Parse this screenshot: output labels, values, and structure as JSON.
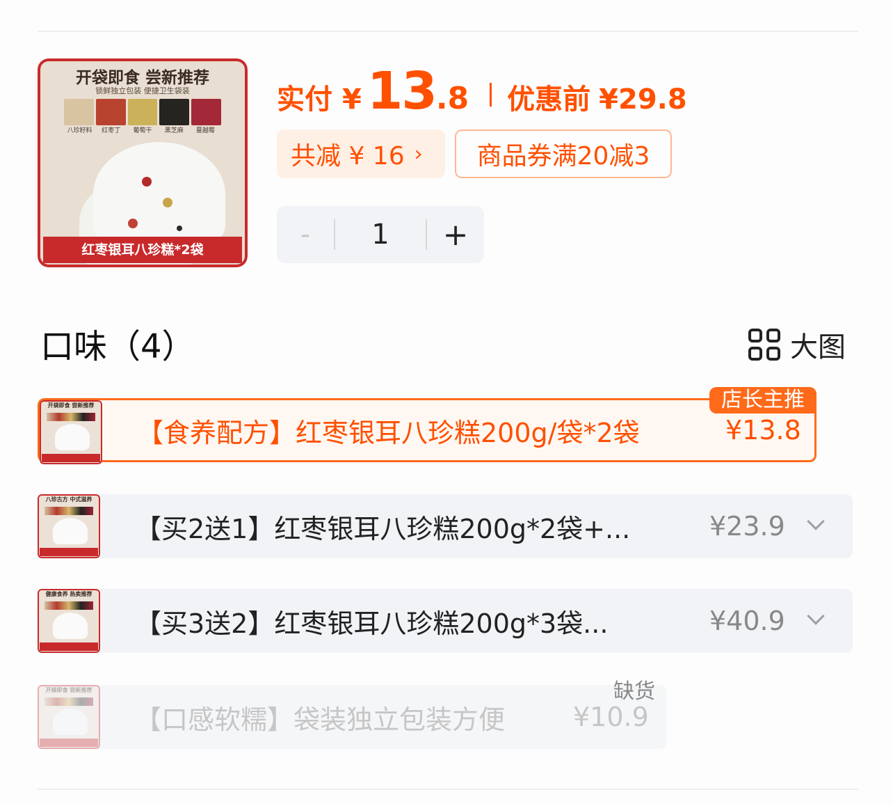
{
  "product": {
    "thumb": {
      "headline": "开袋即食 尝新推荐",
      "subline": "锁鲜独立包装 便捷卫生袋装",
      "ingredients": [
        "八珍籽料",
        "红枣丁",
        "葡萄干",
        "黑芝麻",
        "蔓越莓"
      ],
      "ingredient_colors": [
        "#d9c4a2",
        "#b8432f",
        "#cbb15a",
        "#262421",
        "#a32838"
      ],
      "banner": "红枣银耳八珍糕*2袋"
    },
    "price_label": "实付",
    "currency": "¥",
    "price_int": "13",
    "price_dec": ".8",
    "orig_label": "优惠前",
    "orig_price": "¥29.8",
    "save_label": "共减 ¥ 16",
    "save_chevron": "›",
    "coupon_label": "商品券满20减3",
    "quantity": {
      "minus": "-",
      "value": "1",
      "plus": "+"
    }
  },
  "section": {
    "title": "口味（4）",
    "bigview_label": "大图"
  },
  "options": [
    {
      "thumb_headline": "开袋即食 尝新推荐",
      "thumb_banner": "红枣银耳八珍糕*2袋",
      "name": "【食养配方】红枣银耳八珍糕200g/袋*2袋",
      "price": "¥13.8",
      "tag": "店长主推",
      "selected": true
    },
    {
      "thumb_headline": "八珍古方 中式滋养",
      "thumb_banner": "买二送一 实发三袋",
      "name": "【买2送1】红枣银耳八珍糕200g*2袋+...",
      "price": "¥23.9"
    },
    {
      "thumb_headline": "健康食养 热卖推荐",
      "thumb_banner": "买三送二 实发五袋",
      "name": "【买3送2】红枣银耳八珍糕200g*3袋...",
      "price": "¥40.9"
    },
    {
      "thumb_headline": "开袋即食 尝新推荐",
      "thumb_banner": "红枣银耳八珍糕*1袋",
      "name": "【口感软糯】袋装独立包装方便",
      "price": "¥10.9",
      "tag": "缺货",
      "out_of_stock": true
    }
  ],
  "colors": {
    "accent": "#ff5000",
    "brand_red": "#c82a2c"
  },
  "icons": [
    "grid-icon",
    "chevron-right-icon",
    "chevron-down-icon"
  ]
}
